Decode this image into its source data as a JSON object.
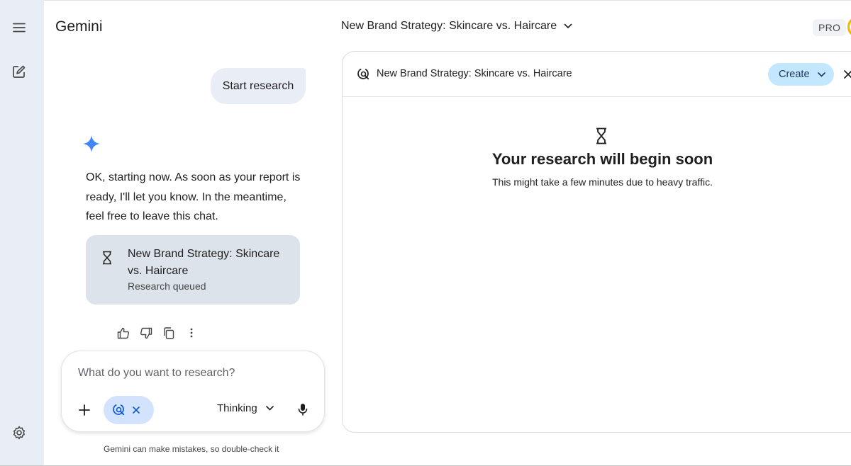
{
  "app": {
    "title": "Gemini"
  },
  "header": {
    "chat_title": "New Brand Strategy: Skincare vs. Haircare",
    "pro_badge": "PRO"
  },
  "rail": {
    "icons": [
      "menu-icon",
      "new-chat-icon",
      "settings-icon"
    ]
  },
  "chat": {
    "user_message": "Start research",
    "reply_text": "OK, starting now. As soon as your report is ready, I'll let you know. In the meantime, feel free to leave this chat.",
    "research_card": {
      "title": "New Brand Strategy: Skincare vs. Haircare",
      "status": "Research queued"
    },
    "actions": [
      "thumbs-up-icon",
      "thumbs-down-icon",
      "copy-icon",
      "more-vert-icon"
    ]
  },
  "composer": {
    "placeholder": "What do you want to research?",
    "mode_label": "Thinking"
  },
  "disclaimer": "Gemini can make mistakes, so double-check it",
  "panel": {
    "title": "New Brand Strategy: Skincare vs. Haircare",
    "create_label": "Create",
    "state_title": "Your research will begin soon",
    "state_subtitle": "This might take a few minutes due to heavy traffic."
  },
  "colors": {
    "rail_bg": "#e9eef6",
    "accent_chip": "#d3e3fd",
    "create_button": "#c2e7ff",
    "spark_blue": "#4285f4",
    "avatar_ring": "#f5b400"
  }
}
